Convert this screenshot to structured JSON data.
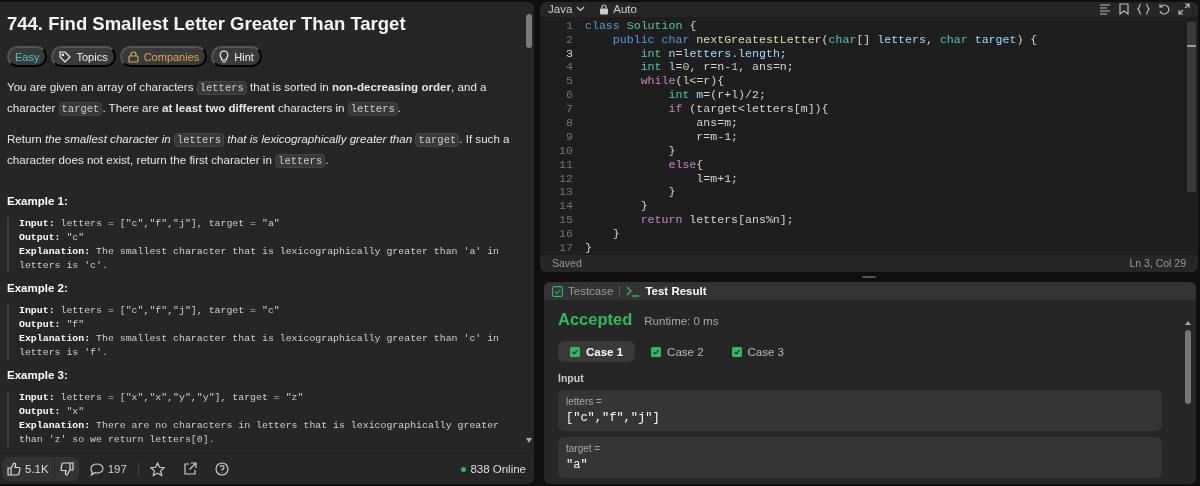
{
  "problem": {
    "title": "744. Find Smallest Letter Greater Than Target",
    "tags": [
      {
        "label": "Easy",
        "kind": "difficulty"
      },
      {
        "label": "Topics",
        "kind": "topics"
      },
      {
        "label": "Companies",
        "kind": "companies"
      },
      {
        "label": "Hint",
        "kind": "hint"
      }
    ],
    "paragraphs": [
      [
        {
          "text": "You are given an array of characters ",
          "kind": "text"
        },
        {
          "text": "letters",
          "kind": "code"
        },
        {
          "text": " that is sorted in ",
          "kind": "text"
        },
        {
          "text": "non-decreasing order",
          "kind": "bold"
        },
        {
          "text": ", and a character ",
          "kind": "text"
        },
        {
          "text": "target",
          "kind": "code"
        },
        {
          "text": ". There are ",
          "kind": "text"
        },
        {
          "text": "at least two different",
          "kind": "bold"
        },
        {
          "text": " characters in ",
          "kind": "text"
        },
        {
          "text": "letters",
          "kind": "code"
        },
        {
          "text": ".",
          "kind": "text"
        }
      ],
      [
        {
          "text": "Return ",
          "kind": "text"
        },
        {
          "text": "the smallest character in ",
          "kind": "italic"
        },
        {
          "text": "letters",
          "kind": "code"
        },
        {
          "text": " that is lexicographically greater than ",
          "kind": "italic"
        },
        {
          "text": "target",
          "kind": "code"
        },
        {
          "text": ". If such a character does not exist, return the first character in ",
          "kind": "text"
        },
        {
          "text": "letters",
          "kind": "code"
        },
        {
          "text": ".",
          "kind": "text"
        }
      ]
    ],
    "examples": [
      {
        "title": "Example 1:",
        "lines": [
          {
            "label": "Input:",
            "value": "letters = [\"c\",\"f\",\"j\"], target = \"a\""
          },
          {
            "label": "Output:",
            "value": "\"c\""
          },
          {
            "label": "Explanation:",
            "value": "The smallest character that is lexicographically greater than 'a' in letters is 'c'."
          }
        ]
      },
      {
        "title": "Example 2:",
        "lines": [
          {
            "label": "Input:",
            "value": "letters = [\"c\",\"f\",\"j\"], target = \"c\""
          },
          {
            "label": "Output:",
            "value": "\"f\""
          },
          {
            "label": "Explanation:",
            "value": "The smallest character that is lexicographically greater than 'c' in letters is 'f'."
          }
        ]
      },
      {
        "title": "Example 3:",
        "lines": [
          {
            "label": "Input:",
            "value": "letters = [\"x\",\"x\",\"y\",\"y\"], target = \"z\""
          },
          {
            "label": "Output:",
            "value": "\"x\""
          },
          {
            "label": "Explanation:",
            "value": "There are no characters in letters that is lexicographically greater than 'z' so we return letters[0]."
          }
        ]
      }
    ]
  },
  "footer": {
    "likes": "5.1K",
    "comments": "197",
    "online": "838 Online"
  },
  "editor": {
    "language": "Java",
    "mode": "Auto",
    "lines": [
      {
        "number": "1",
        "current": false,
        "tokens": [
          {
            "text": "class ",
            "kind": "keyword"
          },
          {
            "text": "Solution",
            "kind": "type"
          },
          {
            "text": " {",
            "kind": "plain"
          }
        ]
      },
      {
        "number": "2",
        "current": false,
        "tokens": [
          {
            "text": "    public ",
            "kind": "keyword"
          },
          {
            "text": "char ",
            "kind": "keyword"
          },
          {
            "text": "nextGreatestLetter",
            "kind": "function"
          },
          {
            "text": "(",
            "kind": "plain"
          },
          {
            "text": "char",
            "kind": "type"
          },
          {
            "text": "[] ",
            "kind": "plain"
          },
          {
            "text": "letters",
            "kind": "variable"
          },
          {
            "text": ", ",
            "kind": "plain"
          },
          {
            "text": "char ",
            "kind": "type"
          },
          {
            "text": "target",
            "kind": "variable"
          },
          {
            "text": ") {",
            "kind": "plain"
          }
        ]
      },
      {
        "number": "3",
        "current": true,
        "tokens": [
          {
            "text": "        int ",
            "kind": "type"
          },
          {
            "text": "n",
            "kind": "variable"
          },
          {
            "text": "=",
            "kind": "plain"
          },
          {
            "text": "letters",
            "kind": "variable"
          },
          {
            "text": ".",
            "kind": "plain"
          },
          {
            "text": "length",
            "kind": "variable"
          },
          {
            "text": ";",
            "kind": "plain"
          }
        ]
      },
      {
        "number": "4",
        "current": false,
        "tokens": [
          {
            "text": "        int ",
            "kind": "type"
          },
          {
            "text": "l",
            "kind": "variable"
          },
          {
            "text": "=",
            "kind": "plain"
          },
          {
            "text": "0",
            "kind": "number"
          },
          {
            "text": ", r=n-",
            "kind": "plain"
          },
          {
            "text": "1",
            "kind": "number"
          },
          {
            "text": ", ans=n;",
            "kind": "plain"
          }
        ]
      },
      {
        "number": "5",
        "current": false,
        "tokens": [
          {
            "text": "        while",
            "kind": "control"
          },
          {
            "text": "(l<=r){",
            "kind": "plain"
          }
        ]
      },
      {
        "number": "6",
        "current": false,
        "tokens": [
          {
            "text": "            int ",
            "kind": "type"
          },
          {
            "text": "m",
            "kind": "variable"
          },
          {
            "text": "=(r+l)/2;",
            "kind": "plain"
          }
        ]
      },
      {
        "number": "7",
        "current": false,
        "tokens": [
          {
            "text": "            if",
            "kind": "control"
          },
          {
            "text": " (target<letters[m]){",
            "kind": "plain"
          }
        ]
      },
      {
        "number": "8",
        "current": false,
        "tokens": [
          {
            "text": "                ans=m;",
            "kind": "plain"
          }
        ]
      },
      {
        "number": "9",
        "current": false,
        "tokens": [
          {
            "text": "                r=m-1;",
            "kind": "plain"
          }
        ]
      },
      {
        "number": "10",
        "current": false,
        "tokens": [
          {
            "text": "            }",
            "kind": "plain"
          }
        ]
      },
      {
        "number": "11",
        "current": false,
        "tokens": [
          {
            "text": "            else",
            "kind": "control"
          },
          {
            "text": "{",
            "kind": "plain"
          }
        ]
      },
      {
        "number": "12",
        "current": false,
        "tokens": [
          {
            "text": "                l=m+1;",
            "kind": "plain"
          }
        ]
      },
      {
        "number": "13",
        "current": false,
        "tokens": [
          {
            "text": "            }",
            "kind": "plain"
          }
        ]
      },
      {
        "number": "14",
        "current": false,
        "tokens": [
          {
            "text": "        }",
            "kind": "plain"
          }
        ]
      },
      {
        "number": "15",
        "current": false,
        "tokens": [
          {
            "text": "        return",
            "kind": "control"
          },
          {
            "text": " letters[ans%n];",
            "kind": "plain"
          }
        ]
      },
      {
        "number": "16",
        "current": false,
        "tokens": [
          {
            "text": "    }",
            "kind": "plain"
          }
        ]
      },
      {
        "number": "17",
        "current": false,
        "tokens": [
          {
            "text": "}",
            "kind": "plain"
          }
        ]
      }
    ],
    "status": "Saved",
    "cursor": "Ln 3, Col 29"
  },
  "results": {
    "tabs": [
      {
        "label": "Testcase",
        "selected": false,
        "kind": "testcase"
      },
      {
        "label": "Test Result",
        "selected": true,
        "kind": "result"
      }
    ],
    "verdict": "Accepted",
    "runtime": "Runtime: 0 ms",
    "cases": [
      {
        "label": "Case 1",
        "selected": true
      },
      {
        "label": "Case 2",
        "selected": false
      },
      {
        "label": "Case 3",
        "selected": false
      }
    ],
    "input_heading": "Input",
    "inputs": [
      {
        "name": "letters =",
        "value": "[\"c\",\"f\",\"j\"]"
      },
      {
        "name": "target =",
        "value": "\"a\""
      }
    ]
  }
}
